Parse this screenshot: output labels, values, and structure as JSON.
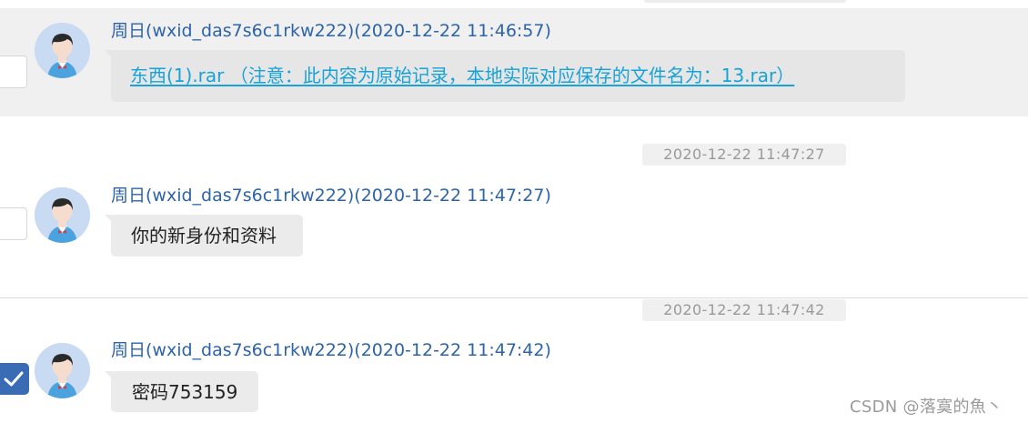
{
  "messages": [
    {
      "sender": "周日(wxid_das7s6c1rkw222)(2020-12-22 11:46:57)",
      "file_link": "东西(1).rar （注意：此内容为原始记录，本地实际对应保存的文件名为：13.rar）",
      "selected": false
    },
    {
      "timestamp": "2020-12-22 11:47:27",
      "sender": "周日(wxid_das7s6c1rkw222)(2020-12-22 11:47:27)",
      "text": "你的新身份和资料",
      "selected": false
    },
    {
      "timestamp": "2020-12-22 11:47:42",
      "sender": "周日(wxid_das7s6c1rkw222)(2020-12-22 11:47:42)",
      "text": "密码753159",
      "selected": true
    }
  ],
  "watermark": "CSDN @落寞的魚丶",
  "colors": {
    "sender": "#2d64a8",
    "link": "#17a2d8",
    "checkbox_checked": "#3a6bb5",
    "highlight_row": "#f0f0f0",
    "bubble": "#ebebeb"
  }
}
